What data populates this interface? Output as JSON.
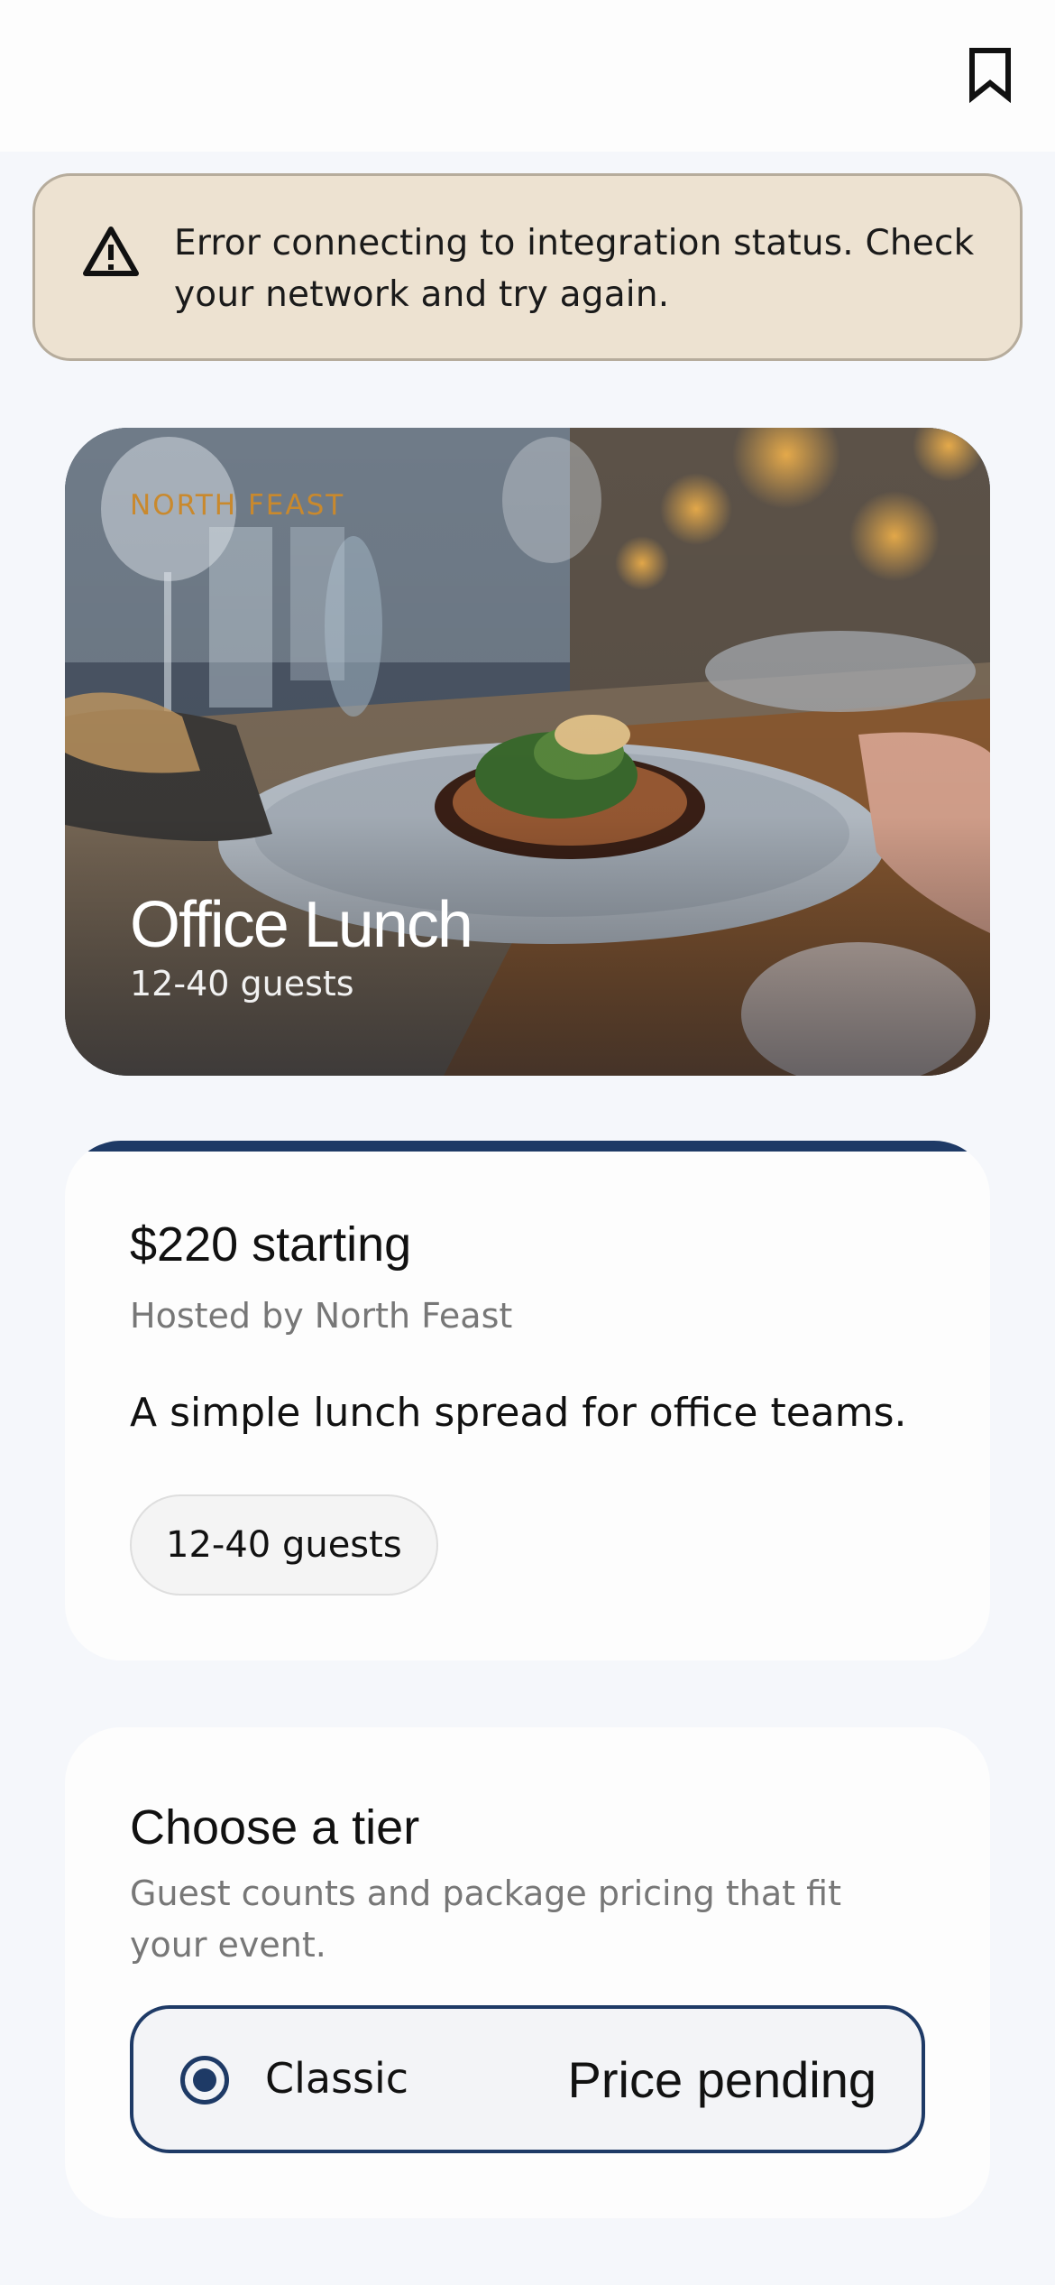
{
  "header": {
    "bookmark_icon": "bookmark-icon"
  },
  "alert": {
    "icon": "warning-icon",
    "message": "Error connecting to integration status. Check your network and try again."
  },
  "hero": {
    "brand": "NORTH FEAST",
    "title": "Office Lunch",
    "guests": "12-40 guests"
  },
  "details": {
    "price": "$220 starting",
    "host": "Hosted by North Feast",
    "description": "A simple lunch spread for office teams.",
    "guest_chip": "12-40 guests"
  },
  "tiers": {
    "title": "Choose a tier",
    "subtitle": "Guest counts and package pricing that fit your event.",
    "options": [
      {
        "name": "Classic",
        "price": "Price pending",
        "selected": true
      }
    ]
  },
  "colors": {
    "accent": "#1e3a66",
    "alert_bg": "#ede2d1",
    "brand_text": "#c9892d"
  }
}
